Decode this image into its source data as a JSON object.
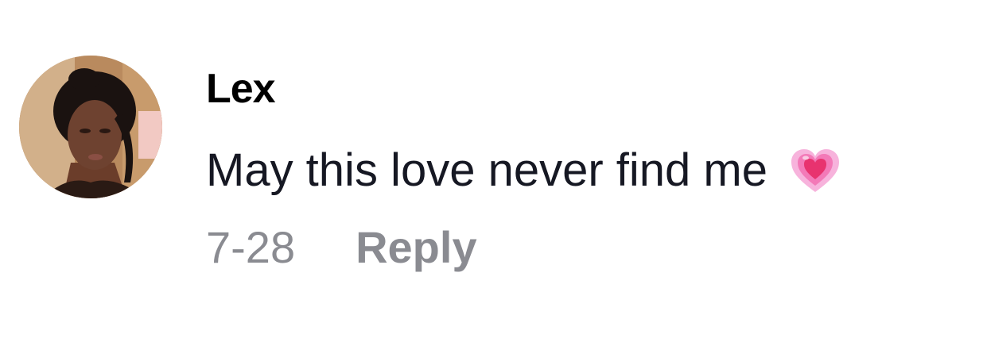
{
  "comment": {
    "username": "Lex",
    "text": "May this love never find me",
    "emoji_icon": "growing-heart-icon",
    "date": "7-28",
    "reply_label": "Reply"
  },
  "colors": {
    "username": "#000000",
    "text": "#161823",
    "meta": "#8a8b91",
    "heart_outer": "#f7a6d6",
    "heart_inner": "#e8336f"
  }
}
